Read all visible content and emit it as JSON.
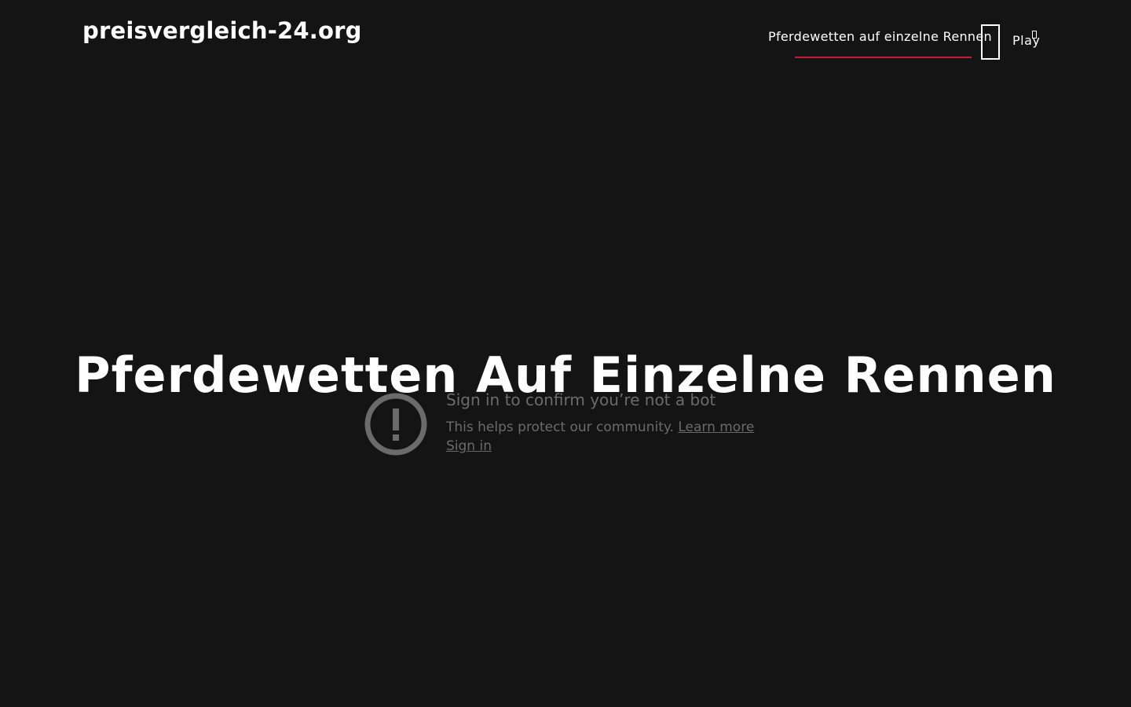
{
  "header": {
    "site_title": "preisvergleich-24.org",
    "nav_link": "Pferdewetten auf einzelne Rennen",
    "play_label": "Play"
  },
  "hero": {
    "title": "Pferdewetten Auf Einzelne Rennen"
  },
  "video_embed": {
    "heading": "Sign in to confirm you’re not a bot",
    "description": "This helps protect our community.",
    "learn_more": "Learn more",
    "sign_in": "Sign in",
    "icon": "exclamation-circle-icon"
  },
  "colors": {
    "background": "#141414",
    "accent_underline": "#c41e3a",
    "muted_text": "#6b6b6b"
  }
}
